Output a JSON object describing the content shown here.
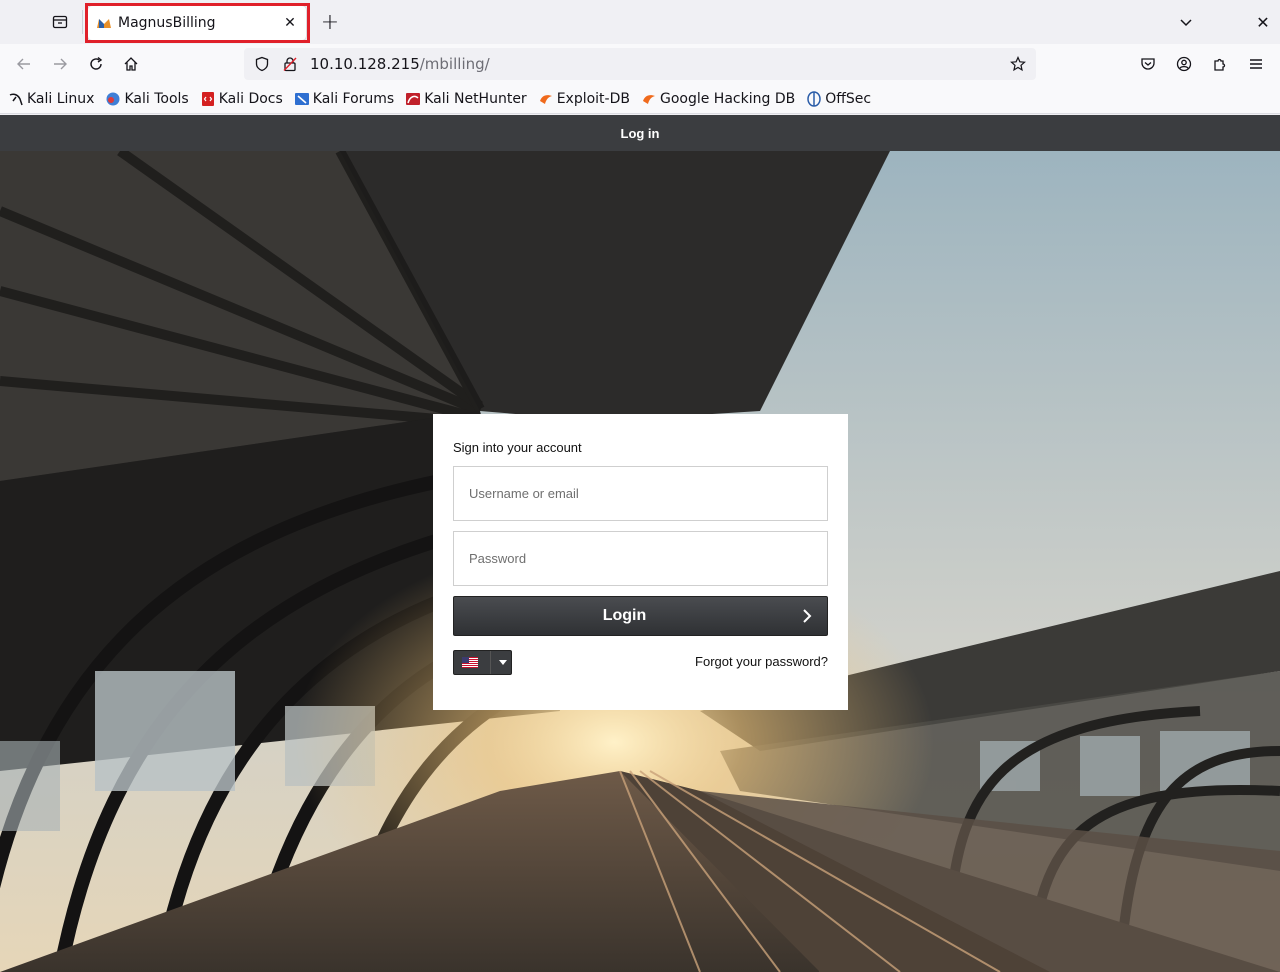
{
  "browser": {
    "tab": {
      "title": "MagnusBilling"
    },
    "url": {
      "host": "10.10.128.215",
      "path": "/mbilling/"
    }
  },
  "bookmarks": [
    {
      "label": "Kali Linux",
      "icon": "kali-dragon-icon"
    },
    {
      "label": "Kali Tools",
      "icon": "kali-tools-icon"
    },
    {
      "label": "Kali Docs",
      "icon": "kali-docs-icon"
    },
    {
      "label": "Kali Forums",
      "icon": "kali-forums-icon"
    },
    {
      "label": "Kali NetHunter",
      "icon": "kali-nethunter-icon"
    },
    {
      "label": "Exploit-DB",
      "icon": "exploit-db-icon"
    },
    {
      "label": "Google Hacking DB",
      "icon": "ghdb-icon"
    },
    {
      "label": "OffSec",
      "icon": "offsec-icon"
    }
  ],
  "page": {
    "header_title": "Log in",
    "login": {
      "heading": "Sign into your account",
      "username_placeholder": "Username or email",
      "password_placeholder": "Password",
      "button_label": "Login",
      "forgot_label": "Forgot your password?",
      "language": "en-US flag"
    }
  }
}
